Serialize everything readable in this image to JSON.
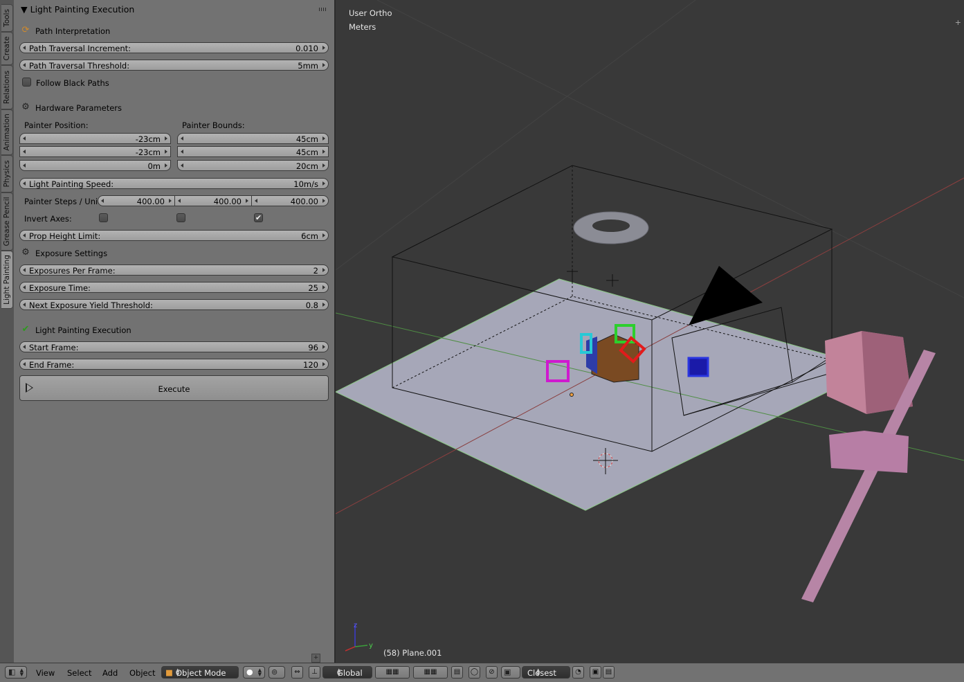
{
  "side_tabs": [
    "Tools",
    "Create",
    "Relations",
    "Animation",
    "Physics",
    "Grease Pencil",
    "Light Painting"
  ],
  "panel": {
    "title": "Light Painting Execution",
    "path": {
      "header": "Path Interpretation",
      "increment_label": "Path Traversal Increment:",
      "increment_value": "0.010",
      "threshold_label": "Path Traversal Threshold:",
      "threshold_value": "5mm",
      "follow_black_label": "Follow Black Paths",
      "follow_black_checked": false
    },
    "hardware": {
      "header": "Hardware Parameters",
      "position_label": "Painter Position:",
      "position": [
        "-23cm",
        "-23cm",
        "0m"
      ],
      "bounds_label": "Painter Bounds:",
      "bounds": [
        "45cm",
        "45cm",
        "20cm"
      ],
      "speed_label": "Light Painting Speed:",
      "speed_value": "10m/s",
      "steps_label": "Painter Steps / Unit:",
      "steps": [
        "400.00",
        "400.00",
        "400.00"
      ],
      "invert_label": "Invert Axes:",
      "invert": [
        false,
        false,
        true
      ],
      "prop_label": "Prop Height Limit:",
      "prop_value": "6cm"
    },
    "exposure": {
      "header": "Exposure Settings",
      "per_frame_label": "Exposures Per Frame:",
      "per_frame_value": "2",
      "time_label": "Exposure Time:",
      "time_value": "25",
      "yield_label": "Next Exposure Yield Threshold:",
      "yield_value": "0.8"
    },
    "execution": {
      "header": "Light Painting Execution",
      "start_label": "Start Frame:",
      "start_value": "96",
      "end_label": "End Frame:",
      "end_value": "120",
      "execute_label": "Execute"
    }
  },
  "viewport": {
    "view_name": "User Ortho",
    "units": "Meters",
    "object_info": "(58) Plane.001",
    "axis_labels": {
      "z": "z",
      "y": "y"
    }
  },
  "header": {
    "menus": [
      "View",
      "Select",
      "Add",
      "Object"
    ],
    "mode": "Object Mode",
    "orientation": "Global",
    "snap_target": "Closest"
  }
}
